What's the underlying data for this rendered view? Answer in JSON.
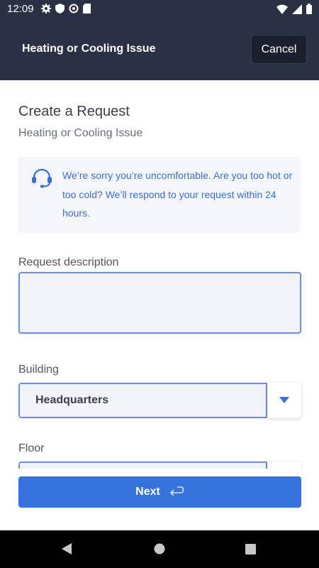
{
  "status_bar": {
    "time": "12:09",
    "left_icons": [
      "settings-icon",
      "shield-icon",
      "vpn-icon",
      "sd-card-icon"
    ],
    "right_icons": [
      "wifi-icon",
      "signal-icon",
      "battery-icon"
    ]
  },
  "header": {
    "title": "Heating or Cooling Issue",
    "cancel_label": "Cancel"
  },
  "main": {
    "title": "Create a Request",
    "subtitle": "Heating or Cooling Issue",
    "info": {
      "icon": "headset-icon",
      "text": "We’re sorry you’re uncomfortable. Are you too hot or too cold? We’ll respond to your request within 24 hours."
    },
    "description": {
      "label": "Request description",
      "value": ""
    },
    "building": {
      "label": "Building",
      "value": "Headquarters"
    },
    "floor": {
      "label": "Floor",
      "value": ""
    }
  },
  "footer": {
    "next_label": "Next",
    "next_icon": "return-arrow-icon"
  },
  "nav": {
    "icons": [
      "back-icon",
      "home-icon",
      "recents-icon"
    ]
  },
  "colors": {
    "header_bg": "#2b3144",
    "accent": "#3572dc",
    "info_text": "#3b6fd4",
    "field_border": "#6c8ee6"
  }
}
